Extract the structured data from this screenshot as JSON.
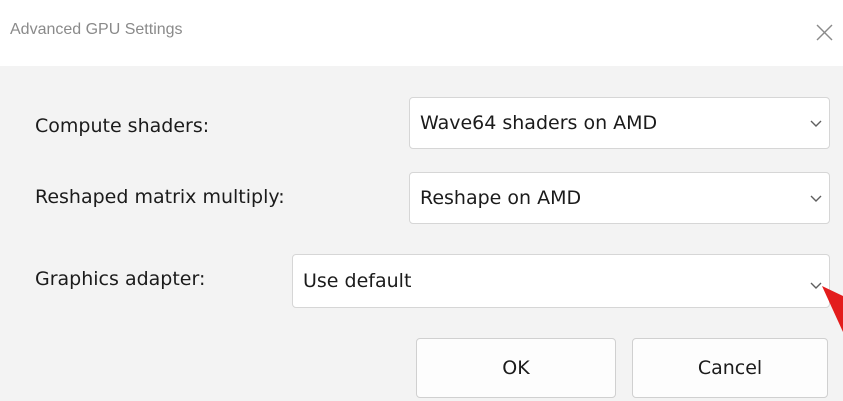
{
  "window": {
    "title": "Advanced GPU Settings"
  },
  "icons": {
    "close": "close-icon",
    "dropdown": "chevron-down-icon",
    "cursor": "pointer-arrow-icon"
  },
  "form": {
    "compute_shaders": {
      "label": "Compute shaders:",
      "value": "Wave64 shaders on AMD"
    },
    "reshaped_matrix": {
      "label": "Reshaped matrix multiply:",
      "value": "Reshape on AMD"
    },
    "graphics_adapter": {
      "label": "Graphics adapter:",
      "value": "Use default"
    }
  },
  "buttons": {
    "ok": "OK",
    "cancel": "Cancel"
  },
  "colors": {
    "cursor": "#e31c1c",
    "dialog_bg": "#f3f3f3"
  }
}
